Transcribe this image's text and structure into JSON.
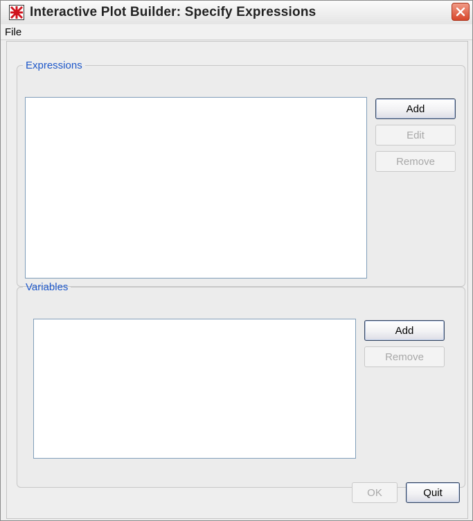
{
  "window": {
    "title": "Interactive Plot Builder: Specify Expressions",
    "close_label": "×"
  },
  "menu": {
    "items": [
      {
        "label": "File"
      }
    ]
  },
  "expressions": {
    "legend": "Expressions",
    "items": [],
    "buttons": {
      "add": "Add",
      "edit": "Edit",
      "remove": "Remove"
    }
  },
  "variables": {
    "legend": "Variables",
    "items": [],
    "buttons": {
      "add": "Add",
      "remove": "Remove"
    }
  },
  "footer": {
    "ok": "OK",
    "quit": "Quit"
  },
  "colors": {
    "legend": "#1d57c9",
    "close_button": "#d7462a",
    "app_icon": "#d0141e"
  },
  "icons": {
    "app": "app-icon",
    "close": "close-icon"
  }
}
